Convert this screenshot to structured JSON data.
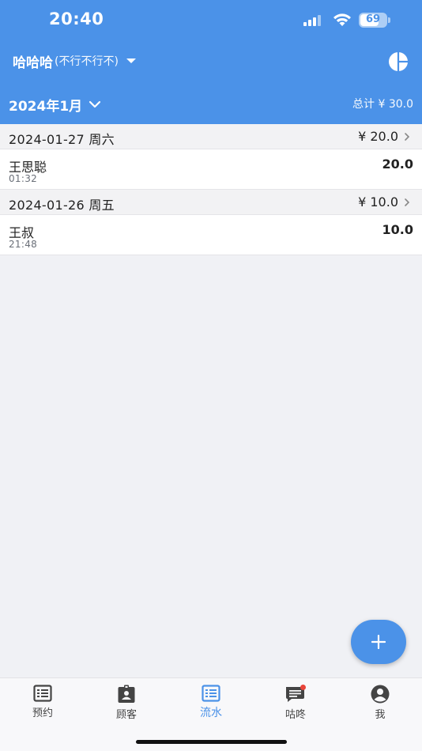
{
  "status_bar": {
    "time": "20:40",
    "battery_level": "69"
  },
  "header": {
    "shop_name": "哈哈哈",
    "shop_subtitle": "(不行不行不)",
    "month": "2024年1月",
    "total": "总计 ¥ 30.0"
  },
  "days": [
    {
      "date": "2024-01-27 周六",
      "total": "¥ 20.0",
      "entries": [
        {
          "name": "王思聪",
          "time": "01:32",
          "amount": "20.0"
        }
      ]
    },
    {
      "date": "2024-01-26 周五",
      "total": "¥ 10.0",
      "entries": [
        {
          "name": "王叔",
          "time": "21:48",
          "amount": "10.0"
        }
      ]
    }
  ],
  "tabs": [
    {
      "label": "预约",
      "icon": "list-icon",
      "active": false
    },
    {
      "label": "顾客",
      "icon": "contact-badge-icon",
      "active": false
    },
    {
      "label": "流水",
      "icon": "list-icon",
      "active": true
    },
    {
      "label": "咕咚",
      "icon": "chat-icon",
      "active": false
    },
    {
      "label": "我",
      "icon": "profile-icon",
      "active": false
    }
  ],
  "colors": {
    "primary": "#4b92e8",
    "background": "#f0f1f5",
    "notification_dot": "#e8443a"
  }
}
